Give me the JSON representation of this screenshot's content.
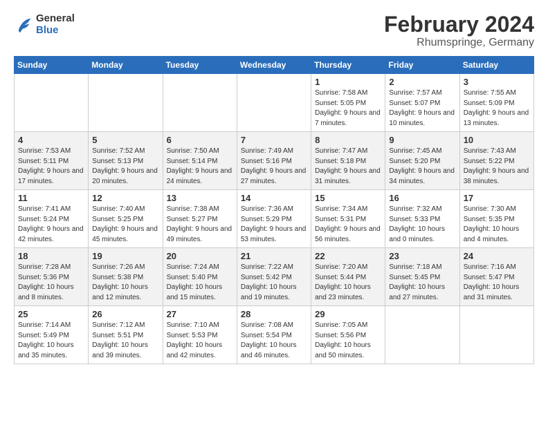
{
  "logo": {
    "line1": "General",
    "line2": "Blue"
  },
  "title": "February 2024",
  "subtitle": "Rhumspringe, Germany",
  "headers": [
    "Sunday",
    "Monday",
    "Tuesday",
    "Wednesday",
    "Thursday",
    "Friday",
    "Saturday"
  ],
  "weeks": [
    [
      {
        "day": "",
        "sunrise": "",
        "sunset": "",
        "daylight": ""
      },
      {
        "day": "",
        "sunrise": "",
        "sunset": "",
        "daylight": ""
      },
      {
        "day": "",
        "sunrise": "",
        "sunset": "",
        "daylight": ""
      },
      {
        "day": "",
        "sunrise": "",
        "sunset": "",
        "daylight": ""
      },
      {
        "day": "1",
        "sunrise": "Sunrise: 7:58 AM",
        "sunset": "Sunset: 5:05 PM",
        "daylight": "Daylight: 9 hours and 7 minutes."
      },
      {
        "day": "2",
        "sunrise": "Sunrise: 7:57 AM",
        "sunset": "Sunset: 5:07 PM",
        "daylight": "Daylight: 9 hours and 10 minutes."
      },
      {
        "day": "3",
        "sunrise": "Sunrise: 7:55 AM",
        "sunset": "Sunset: 5:09 PM",
        "daylight": "Daylight: 9 hours and 13 minutes."
      }
    ],
    [
      {
        "day": "4",
        "sunrise": "Sunrise: 7:53 AM",
        "sunset": "Sunset: 5:11 PM",
        "daylight": "Daylight: 9 hours and 17 minutes."
      },
      {
        "day": "5",
        "sunrise": "Sunrise: 7:52 AM",
        "sunset": "Sunset: 5:13 PM",
        "daylight": "Daylight: 9 hours and 20 minutes."
      },
      {
        "day": "6",
        "sunrise": "Sunrise: 7:50 AM",
        "sunset": "Sunset: 5:14 PM",
        "daylight": "Daylight: 9 hours and 24 minutes."
      },
      {
        "day": "7",
        "sunrise": "Sunrise: 7:49 AM",
        "sunset": "Sunset: 5:16 PM",
        "daylight": "Daylight: 9 hours and 27 minutes."
      },
      {
        "day": "8",
        "sunrise": "Sunrise: 7:47 AM",
        "sunset": "Sunset: 5:18 PM",
        "daylight": "Daylight: 9 hours and 31 minutes."
      },
      {
        "day": "9",
        "sunrise": "Sunrise: 7:45 AM",
        "sunset": "Sunset: 5:20 PM",
        "daylight": "Daylight: 9 hours and 34 minutes."
      },
      {
        "day": "10",
        "sunrise": "Sunrise: 7:43 AM",
        "sunset": "Sunset: 5:22 PM",
        "daylight": "Daylight: 9 hours and 38 minutes."
      }
    ],
    [
      {
        "day": "11",
        "sunrise": "Sunrise: 7:41 AM",
        "sunset": "Sunset: 5:24 PM",
        "daylight": "Daylight: 9 hours and 42 minutes."
      },
      {
        "day": "12",
        "sunrise": "Sunrise: 7:40 AM",
        "sunset": "Sunset: 5:25 PM",
        "daylight": "Daylight: 9 hours and 45 minutes."
      },
      {
        "day": "13",
        "sunrise": "Sunrise: 7:38 AM",
        "sunset": "Sunset: 5:27 PM",
        "daylight": "Daylight: 9 hours and 49 minutes."
      },
      {
        "day": "14",
        "sunrise": "Sunrise: 7:36 AM",
        "sunset": "Sunset: 5:29 PM",
        "daylight": "Daylight: 9 hours and 53 minutes."
      },
      {
        "day": "15",
        "sunrise": "Sunrise: 7:34 AM",
        "sunset": "Sunset: 5:31 PM",
        "daylight": "Daylight: 9 hours and 56 minutes."
      },
      {
        "day": "16",
        "sunrise": "Sunrise: 7:32 AM",
        "sunset": "Sunset: 5:33 PM",
        "daylight": "Daylight: 10 hours and 0 minutes."
      },
      {
        "day": "17",
        "sunrise": "Sunrise: 7:30 AM",
        "sunset": "Sunset: 5:35 PM",
        "daylight": "Daylight: 10 hours and 4 minutes."
      }
    ],
    [
      {
        "day": "18",
        "sunrise": "Sunrise: 7:28 AM",
        "sunset": "Sunset: 5:36 PM",
        "daylight": "Daylight: 10 hours and 8 minutes."
      },
      {
        "day": "19",
        "sunrise": "Sunrise: 7:26 AM",
        "sunset": "Sunset: 5:38 PM",
        "daylight": "Daylight: 10 hours and 12 minutes."
      },
      {
        "day": "20",
        "sunrise": "Sunrise: 7:24 AM",
        "sunset": "Sunset: 5:40 PM",
        "daylight": "Daylight: 10 hours and 15 minutes."
      },
      {
        "day": "21",
        "sunrise": "Sunrise: 7:22 AM",
        "sunset": "Sunset: 5:42 PM",
        "daylight": "Daylight: 10 hours and 19 minutes."
      },
      {
        "day": "22",
        "sunrise": "Sunrise: 7:20 AM",
        "sunset": "Sunset: 5:44 PM",
        "daylight": "Daylight: 10 hours and 23 minutes."
      },
      {
        "day": "23",
        "sunrise": "Sunrise: 7:18 AM",
        "sunset": "Sunset: 5:45 PM",
        "daylight": "Daylight: 10 hours and 27 minutes."
      },
      {
        "day": "24",
        "sunrise": "Sunrise: 7:16 AM",
        "sunset": "Sunset: 5:47 PM",
        "daylight": "Daylight: 10 hours and 31 minutes."
      }
    ],
    [
      {
        "day": "25",
        "sunrise": "Sunrise: 7:14 AM",
        "sunset": "Sunset: 5:49 PM",
        "daylight": "Daylight: 10 hours and 35 minutes."
      },
      {
        "day": "26",
        "sunrise": "Sunrise: 7:12 AM",
        "sunset": "Sunset: 5:51 PM",
        "daylight": "Daylight: 10 hours and 39 minutes."
      },
      {
        "day": "27",
        "sunrise": "Sunrise: 7:10 AM",
        "sunset": "Sunset: 5:53 PM",
        "daylight": "Daylight: 10 hours and 42 minutes."
      },
      {
        "day": "28",
        "sunrise": "Sunrise: 7:08 AM",
        "sunset": "Sunset: 5:54 PM",
        "daylight": "Daylight: 10 hours and 46 minutes."
      },
      {
        "day": "29",
        "sunrise": "Sunrise: 7:05 AM",
        "sunset": "Sunset: 5:56 PM",
        "daylight": "Daylight: 10 hours and 50 minutes."
      },
      {
        "day": "",
        "sunrise": "",
        "sunset": "",
        "daylight": ""
      },
      {
        "day": "",
        "sunrise": "",
        "sunset": "",
        "daylight": ""
      }
    ]
  ]
}
